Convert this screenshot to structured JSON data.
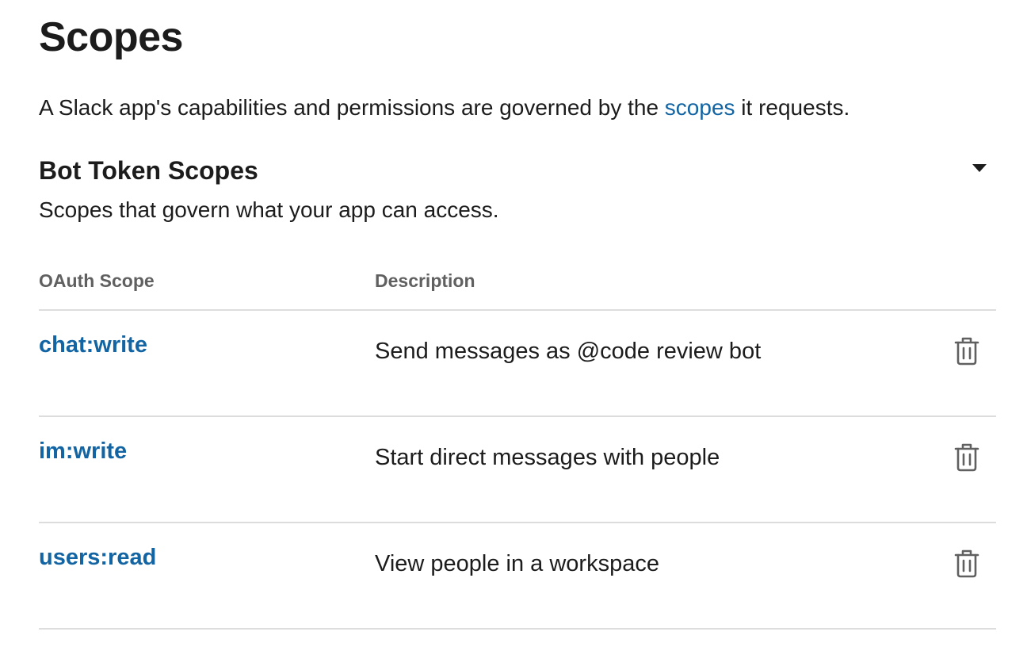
{
  "page": {
    "title": "Scopes",
    "intro_before": "A Slack app's capabilities and permissions are governed by the ",
    "intro_link": "scopes",
    "intro_after": " it requests."
  },
  "section": {
    "title": "Bot Token Scopes",
    "subtitle": "Scopes that govern what your app can access.",
    "toggle_icon": "caret-down-icon"
  },
  "table": {
    "headers": {
      "scope": "OAuth Scope",
      "description": "Description"
    },
    "rows": [
      {
        "scope": "chat:write",
        "description": "Send messages as @code review bot",
        "action_icon": "trash-icon"
      },
      {
        "scope": "im:write",
        "description": "Start direct messages with people",
        "action_icon": "trash-icon"
      },
      {
        "scope": "users:read",
        "description": "View people in a workspace",
        "action_icon": "trash-icon"
      }
    ]
  },
  "colors": {
    "text": "#1d1c1d",
    "link": "#1264a3",
    "muted": "#616061",
    "divider": "#dddddd"
  }
}
